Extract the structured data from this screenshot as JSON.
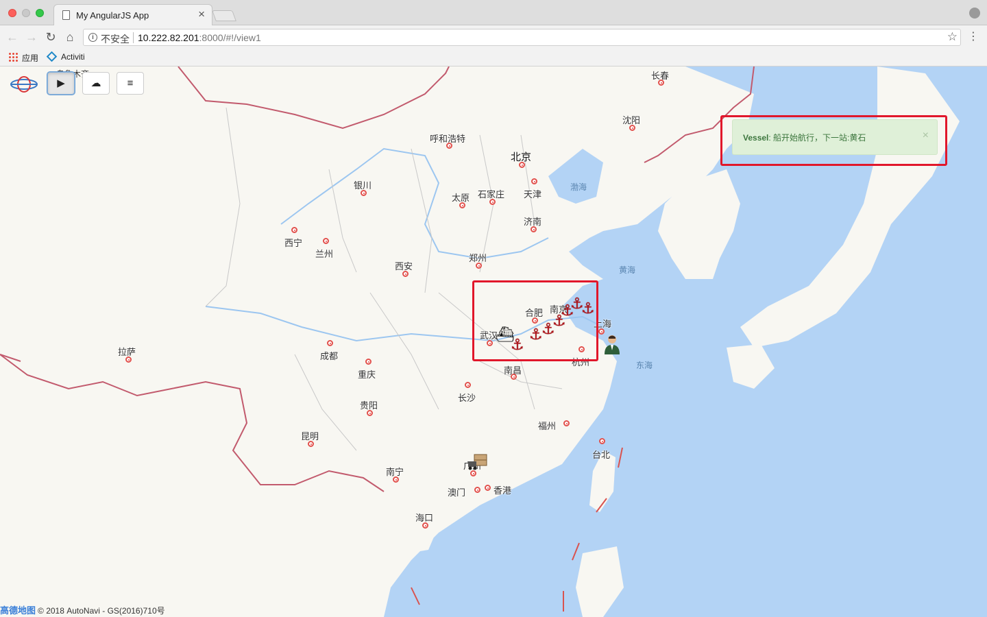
{
  "browser": {
    "tab_title": "My AngularJS App",
    "security_label": "不安全",
    "url_host": "10.222.82.201",
    "url_rest": ":8000/#!/view1",
    "bookmarks": [
      {
        "label": "应用",
        "icon": "apps-grid-icon"
      },
      {
        "label": "Activiti",
        "icon": "activiti-diamond-icon"
      }
    ]
  },
  "controls": {
    "play_icon": "▶",
    "deploy_icon": "☁",
    "menu_icon": "≡"
  },
  "notification": {
    "title": "Vessel",
    "message": ": 船开始航行，下一站:黄石",
    "close": "×",
    "color": "#3c763d"
  },
  "map": {
    "cities": [
      {
        "name": "长春"
      },
      {
        "name": "沈阳"
      },
      {
        "name": "呼和浩特"
      },
      {
        "name": "北京"
      },
      {
        "name": "天津"
      },
      {
        "name": "石家庄"
      },
      {
        "name": "太原"
      },
      {
        "name": "银川"
      },
      {
        "name": "济南"
      },
      {
        "name": "西宁"
      },
      {
        "name": "兰州"
      },
      {
        "name": "西安"
      },
      {
        "name": "郑州"
      },
      {
        "name": "合肥"
      },
      {
        "name": "南京"
      },
      {
        "name": "上海"
      },
      {
        "name": "武汉"
      },
      {
        "name": "杭州"
      },
      {
        "name": "南昌"
      },
      {
        "name": "成都"
      },
      {
        "name": "重庆"
      },
      {
        "name": "拉萨"
      },
      {
        "name": "长沙"
      },
      {
        "name": "贵阳"
      },
      {
        "name": "福州"
      },
      {
        "name": "台北"
      },
      {
        "name": "昆明"
      },
      {
        "name": "南宁"
      },
      {
        "name": "广州"
      },
      {
        "name": "澳门"
      },
      {
        "name": "香港"
      },
      {
        "name": "海口"
      }
    ],
    "seas": [
      {
        "name": "渤海"
      },
      {
        "name": "黄海"
      },
      {
        "name": "东海"
      }
    ],
    "partial_label": "乌鲁木齐",
    "attribution_logo": "高德地图",
    "attribution": "© 2018 AutoNavi - GS(2016)710号"
  },
  "colors": {
    "sea": "#b3d3f5",
    "land": "#f8f7f2",
    "border": "#c25a6d",
    "highlight": "#e1172b",
    "anchor": "#b3141b"
  }
}
